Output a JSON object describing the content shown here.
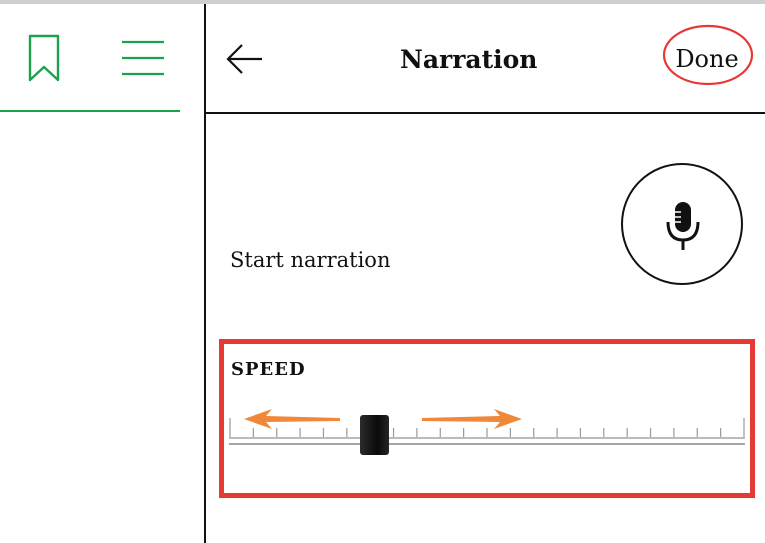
{
  "header": {
    "title": "Narration",
    "done_label": "Done"
  },
  "icons": {
    "bookmark": "bookmark-icon",
    "menu": "menu-icon",
    "back": "back-arrow-icon",
    "microphone": "microphone-icon"
  },
  "narration": {
    "start_label": "Start narration"
  },
  "speed": {
    "label": "SPEED",
    "tick_count": 23,
    "value_fraction": 0.28
  },
  "colors": {
    "accent_green": "#1aa34a",
    "highlight_red": "#e53935",
    "arrow_orange": "#f0883a"
  }
}
